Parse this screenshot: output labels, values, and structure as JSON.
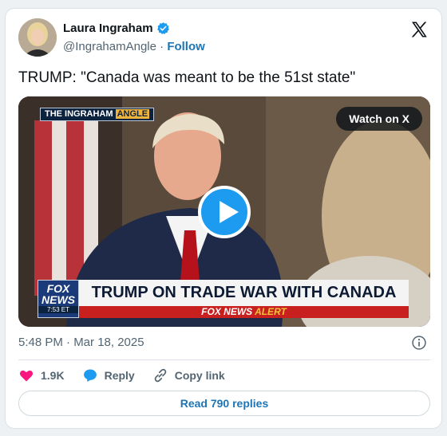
{
  "author": {
    "name": "Laura Ingraham",
    "handle": "@IngrahamAngle",
    "separator": "·",
    "follow_label": "Follow"
  },
  "tweet": {
    "text": "TRUMP: \"Canada was meant to be the 51st state\"",
    "timestamp": "5:48 PM · Mar 18, 2025"
  },
  "media": {
    "watch_label": "Watch on X",
    "show_logo_prefix": "THE INGRAHAM ",
    "show_logo_highlight": "ANGLE",
    "chyron_network": "FOX NEWS",
    "chyron_time": "7:53 ET",
    "chyron_headline": "TRUMP ON TRADE WAR WITH CANADA",
    "chyron_alert_prefix": "FOX NEWS",
    "chyron_alert_word": "ALERT"
  },
  "actions": {
    "likes": "1.9K",
    "reply_label": "Reply",
    "copy_link_label": "Copy link"
  },
  "replies_button": "Read 790 replies",
  "colors": {
    "accent": "#1d9bf0",
    "link": "#1d75b6",
    "like": "#f91880",
    "verified": "#1d9bf0"
  },
  "icons": [
    "verified-badge-icon",
    "x-logo-icon",
    "play-icon",
    "info-icon",
    "heart-icon",
    "reply-icon",
    "link-icon"
  ]
}
